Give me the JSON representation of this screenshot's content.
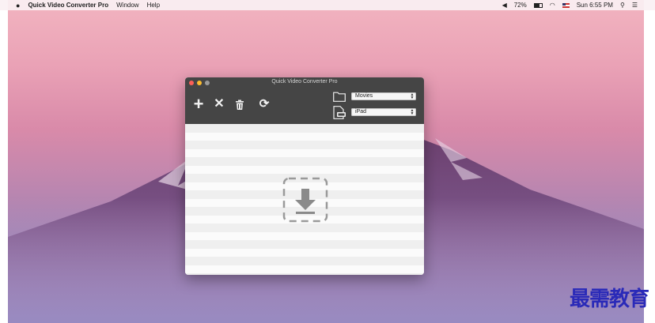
{
  "menubar": {
    "apple_icon": "apple-logo",
    "app_name": "Quick Video Converter Pro",
    "menus": [
      "Window",
      "Help"
    ],
    "volume_icon": "speaker-icon",
    "battery_percent": "72%",
    "wifi_icon": "wifi-icon",
    "clock": "Sun 6:55 PM",
    "search_icon": "spotlight-search-icon",
    "menu_icon": "notification-center-icon"
  },
  "window": {
    "title": "Quick Video Converter Pro",
    "toolbar": {
      "add_icon": "+",
      "remove_icon": "✕",
      "trash_icon": "trash-icon",
      "convert_icon": "⟳"
    },
    "output_folder": {
      "icon": "folder-icon",
      "selected": "Movies"
    },
    "output_device": {
      "icon": "document-icon",
      "selected": "iPad"
    },
    "drop_zone_icon": "download-arrow-icon"
  },
  "watermark": "最需教育"
}
